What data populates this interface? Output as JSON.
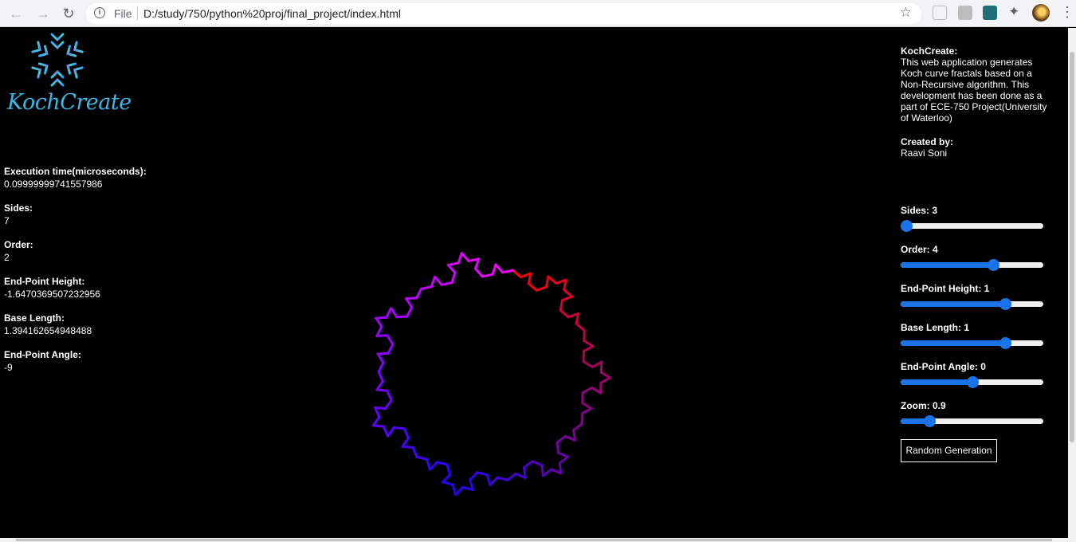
{
  "browser": {
    "scheme": "File",
    "url": "D:/study/750/python%20proj/final_project/index.html"
  },
  "logo": {
    "text": "KochCreate"
  },
  "stats": [
    {
      "label": "Execution time(microseconds):",
      "value": "0.09999999741557986"
    },
    {
      "label": "Sides:",
      "value": "7"
    },
    {
      "label": "Order:",
      "value": "2"
    },
    {
      "label": "End-Point Height:",
      "value": "-1.6470369507232956"
    },
    {
      "label": "Base Length:",
      "value": "1.394162654948488"
    },
    {
      "label": "End-Point Angle:",
      "value": "-9"
    }
  ],
  "about": {
    "title": "KochCreate:",
    "description": "This web application generates Koch curve fractals based on a Non-Recursive algorithm. This development has been done as a part of ECE-750 Project(University of Waterloo)",
    "credit_label": "Created by:",
    "author": "Raavi Soni"
  },
  "controls": [
    {
      "label": "Sides: 3",
      "level": 0.04
    },
    {
      "label": "Order: 4",
      "level": 0.65
    },
    {
      "label": "End-Point Height: 1",
      "level": 0.73
    },
    {
      "label": "Base Length: 1",
      "level": 0.73
    },
    {
      "label": "End-Point Angle: 0",
      "level": 0.5
    },
    {
      "label": "Zoom: 0.9",
      "level": 0.2
    }
  ],
  "random_button": "Random Generation",
  "colors": {
    "slider": "#1a73e8",
    "fractal_start": "#ff0000",
    "fractal_mid": "#2200ff",
    "fractal_end": "#ff00ff"
  }
}
